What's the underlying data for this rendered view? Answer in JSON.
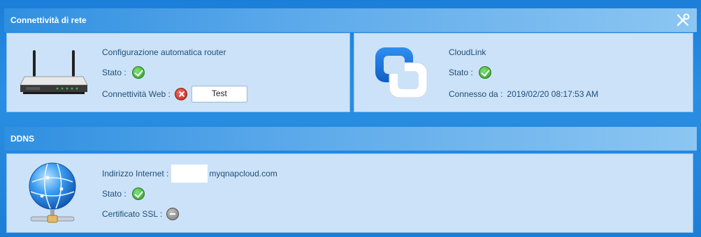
{
  "network": {
    "title": "Connettività di rete",
    "settings_icon": "tools-icon",
    "router": {
      "heading": "Configurazione automatica router",
      "status_label": "Stato :",
      "status": "ok",
      "web_label": "Connettività Web :",
      "web_status": "error",
      "test_button": "Test"
    },
    "cloudlink": {
      "heading": "CloudLink",
      "status_label": "Stato :",
      "status": "ok",
      "connected_label": "Connesso da :",
      "connected_value": "2019/02/20 08:17:53 AM"
    }
  },
  "ddns": {
    "title": "DDNS",
    "internet_label": "Indirizzo Internet :",
    "internet_suffix": "myqnapcloud.com",
    "status_label": "Stato :",
    "status": "ok",
    "ssl_label": "Certificato SSL :",
    "ssl_status": "none"
  }
}
